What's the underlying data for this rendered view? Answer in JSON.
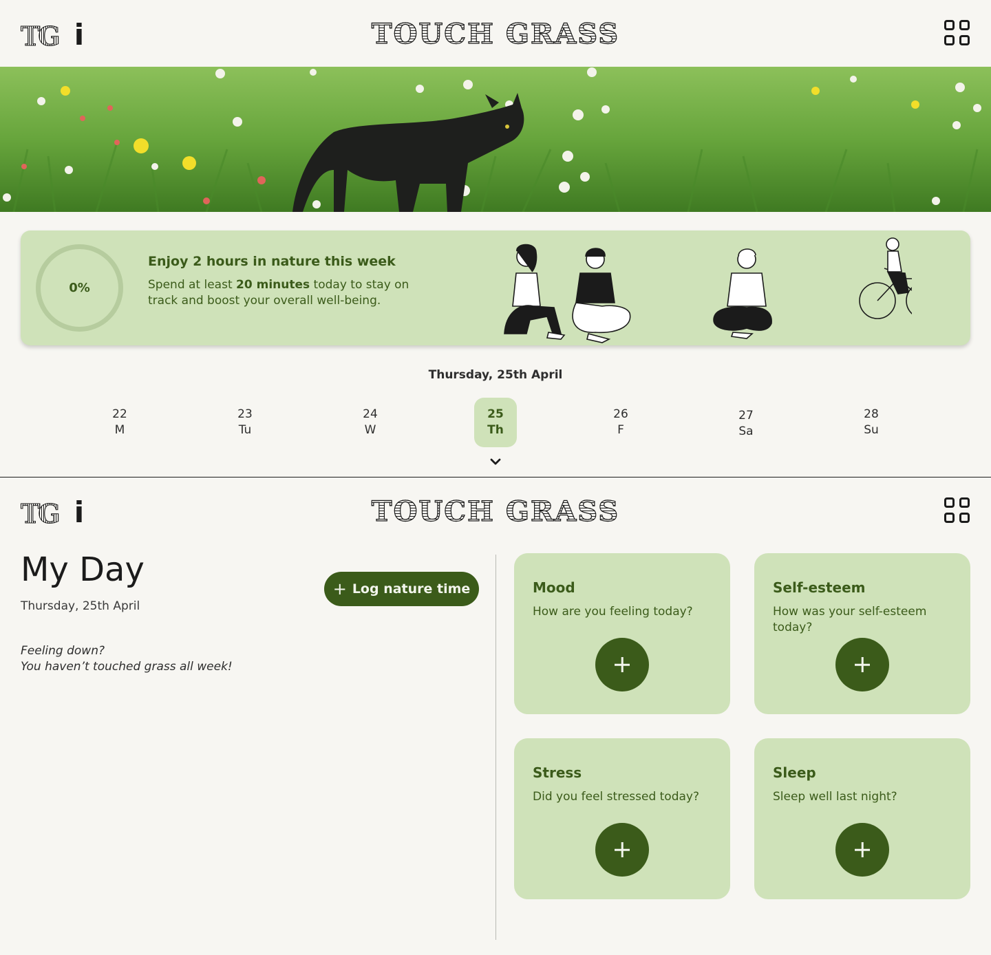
{
  "header": {
    "logo_mark": "TG",
    "info_label": "i",
    "brand": "TOUCH GRASS"
  },
  "hero": {
    "image": "black cat walking through grass and wildflowers"
  },
  "goal": {
    "progress": "0%",
    "title": "Enjoy 2 hours in nature this week",
    "subtitle_prefix": "Spend at least ",
    "subtitle_bold": "20 minutes",
    "subtitle_suffix": " today to stay on track and boost your overall well-being."
  },
  "calendar": {
    "selected_date": "Thursday, 25th April",
    "days": [
      {
        "num": "22",
        "label": "M"
      },
      {
        "num": "23",
        "label": "Tu"
      },
      {
        "num": "24",
        "label": "W"
      },
      {
        "num": "25",
        "label": "Th"
      },
      {
        "num": "26",
        "label": "F"
      },
      {
        "num": "27",
        "label": "Sa"
      },
      {
        "num": "28",
        "label": "Su"
      }
    ],
    "active_index": 3
  },
  "myday": {
    "title": "My Day",
    "date": "Thursday, 25th April",
    "log_button": "Log nature time",
    "feeling_line1": "Feeling down?",
    "feeling_line2": "You haven’t touched grass all week!"
  },
  "metrics": [
    {
      "title": "Mood",
      "question": "How are you feeling today?"
    },
    {
      "title": "Self-esteem",
      "question": "How was your self-esteem today?"
    },
    {
      "title": "Stress",
      "question": "Did you feel stressed today?"
    },
    {
      "title": "Sleep",
      "question": "Sleep well last night?"
    }
  ],
  "colors": {
    "background": "#f7f6f2",
    "card": "#cfe2b9",
    "accent": "#3b5b1a"
  }
}
